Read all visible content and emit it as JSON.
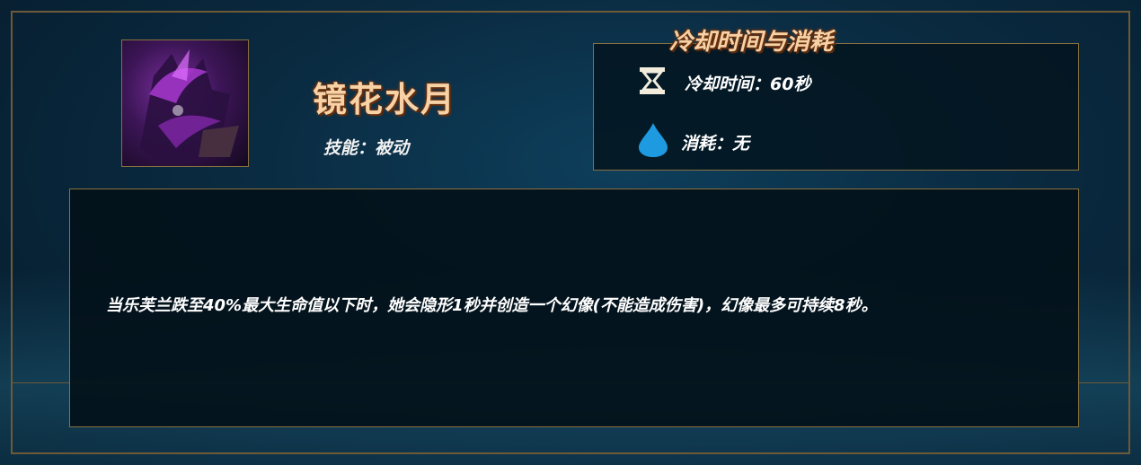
{
  "skill": {
    "name": "镜花水月",
    "type_label": "技能：被动"
  },
  "cooldown_section": {
    "title": "冷却时间与消耗",
    "cooldown": {
      "icon": "hourglass-icon",
      "text": "冷却时间：60秒"
    },
    "cost": {
      "icon": "water-drop-icon",
      "text": "消耗：无"
    }
  },
  "description": "当乐芙兰跌至40%最大生命值以下时，她会隐形1秒并创造一个幻像(不能造成伤害)，幻像最多可持续8秒。",
  "colors": {
    "gold_border": "#8a7140",
    "title_text": "#f6d2a6",
    "drop_blue": "#1e9be0"
  }
}
